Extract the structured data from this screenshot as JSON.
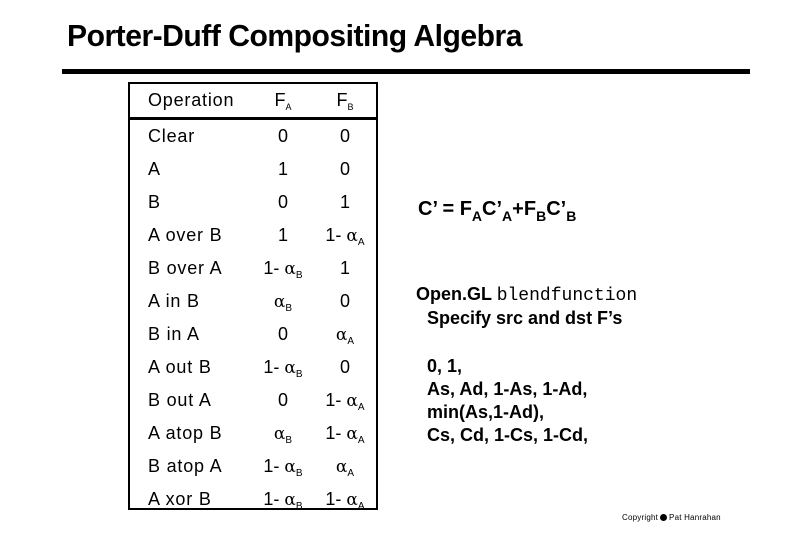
{
  "title": "Porter-Duff Compositing Algebra",
  "table": {
    "headers": {
      "operation": "Operation",
      "fa": "F",
      "fa_sub": "A",
      "fb": "F",
      "fb_sub": "B"
    },
    "rows": [
      {
        "op": "Clear",
        "fa": "0",
        "fa_sub": "",
        "fb": "0",
        "fb_sub": ""
      },
      {
        "op": "A",
        "fa": "1",
        "fa_sub": "",
        "fb": "0",
        "fb_sub": ""
      },
      {
        "op": "B",
        "fa": "0",
        "fa_sub": "",
        "fb": "1",
        "fb_sub": ""
      },
      {
        "op": "A over B",
        "fa": "1",
        "fa_sub": "",
        "fb": "1- α",
        "fb_sub": "A"
      },
      {
        "op": "B over A",
        "fa": "1- α",
        "fa_sub": "B",
        "fb": "1",
        "fb_sub": ""
      },
      {
        "op": "A in B",
        "fa": "α",
        "fa_sub": "B",
        "fb": "0",
        "fb_sub": ""
      },
      {
        "op": "B in A",
        "fa": "0",
        "fa_sub": "",
        "fb": "α",
        "fb_sub": "A"
      },
      {
        "op": "A out B",
        "fa": "1- α",
        "fa_sub": "B",
        "fb": "0",
        "fb_sub": ""
      },
      {
        "op": "B out A",
        "fa": "0",
        "fa_sub": "",
        "fb": "1- α",
        "fb_sub": "A"
      },
      {
        "op": "A atop B",
        "fa": "α",
        "fa_sub": "B",
        "fb": "1- α",
        "fb_sub": "A"
      },
      {
        "op": "B atop A",
        "fa": "1- α",
        "fa_sub": "B",
        "fb": "α",
        "fb_sub": "A"
      },
      {
        "op": "A xor B",
        "fa": "1- α",
        "fa_sub": "B",
        "fb": "1- α",
        "fb_sub": "A"
      }
    ]
  },
  "formula": {
    "lhs": "C’ = F",
    "sub1": "A",
    "t2": "C’",
    "sub2": "A",
    "t3": "+F",
    "sub3": "B",
    "t4": "C’",
    "sub4": "B"
  },
  "opengl": {
    "label": "Open.GL",
    "code": "blendfunction",
    "line2": "Specify src and dst F’s",
    "values": [
      "0, 1,",
      "As, Ad, 1-As, 1-Ad,",
      "min(As,1-Ad),",
      "Cs, Cd, 1-Cs, 1-Cd,"
    ]
  },
  "copyright": {
    "prefix": "Copyright",
    "author": "Pat Hanrahan"
  }
}
